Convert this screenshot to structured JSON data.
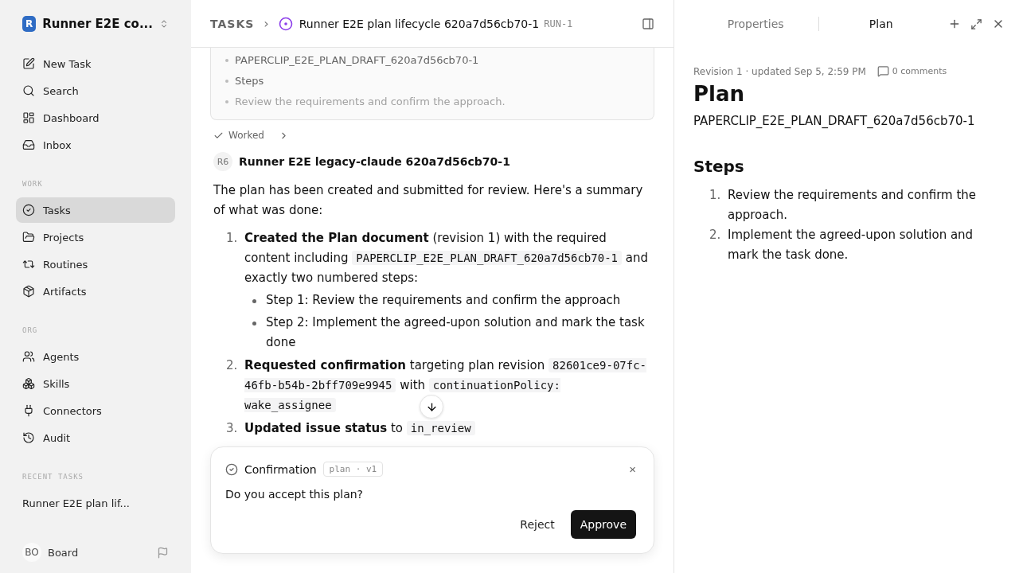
{
  "workspace": {
    "avatar": "R",
    "name": "Runner E2E co..."
  },
  "nav": [
    {
      "label": "New Task",
      "selected": false
    },
    {
      "label": "Search",
      "selected": false
    },
    {
      "label": "Dashboard",
      "selected": false
    },
    {
      "label": "Inbox",
      "selected": false
    }
  ],
  "sections": [
    {
      "title": "WORK",
      "items": [
        {
          "label": "Tasks",
          "selected": true
        },
        {
          "label": "Projects",
          "selected": false
        },
        {
          "label": "Routines",
          "selected": false
        },
        {
          "label": "Artifacts",
          "selected": false
        }
      ]
    },
    {
      "title": "ORG",
      "items": [
        {
          "label": "Agents",
          "selected": false
        },
        {
          "label": "Skills",
          "selected": false
        },
        {
          "label": "Connectors",
          "selected": false
        },
        {
          "label": "Audit",
          "selected": false
        }
      ]
    }
  ],
  "recent": {
    "title": "RECENT TASKS",
    "items": [
      "Runner E2E plan lif..."
    ]
  },
  "user": {
    "initials": "BO",
    "name": "Board"
  },
  "header": {
    "crumb": "TASKS",
    "sep": "›",
    "title": "Runner E2E plan lifecycle 620a7d56cb70-1",
    "id": "RUN-1"
  },
  "draft_card": {
    "items": [
      "PAPERCLIP_E2E_PLAN_DRAFT_620a7d56cb70-1",
      "Steps",
      "Review the requirements and confirm the approach."
    ]
  },
  "worked": {
    "label": "Worked",
    "expanded": false
  },
  "message": {
    "badge": "R6",
    "author": "Runner E2E legacy-claude 620a7d56cb70-1",
    "intro": "The plan has been created and submitted for review. Here's a summary of what was done:",
    "items": [
      {
        "number": "1.",
        "parts": [
          {
            "kind": "bold",
            "text": "Created the Plan document"
          },
          {
            "kind": "plain",
            "text": " (revision 1) with the required content including "
          },
          {
            "kind": "code",
            "text": "PAPERCLIP_E2E_PLAN_DRAFT_620a7d56cb70-1"
          },
          {
            "kind": "plain",
            "text": " and exactly two numbered steps:"
          }
        ],
        "bullets": [
          "Step 1: Review the requirements and confirm the approach",
          "Step 2: Implement the agreed-upon solution and mark the task done"
        ]
      },
      {
        "number": "2.",
        "parts": [
          {
            "kind": "bold",
            "text": "Requested confirmation"
          },
          {
            "kind": "plain",
            "text": " targeting plan revision "
          },
          {
            "kind": "code",
            "text": "82601ce9-07fc-46fb-b54b-2bff709e9945"
          },
          {
            "kind": "plain",
            "text": " with "
          },
          {
            "kind": "code",
            "text": "continuationPolicy: wake_assignee"
          }
        ]
      },
      {
        "number": "3.",
        "parts": [
          {
            "kind": "bold",
            "text": "Updated issue status"
          },
          {
            "kind": "plain",
            "text": " to "
          },
          {
            "kind": "code",
            "text": "in_review"
          }
        ]
      }
    ]
  },
  "confirmation": {
    "title": "Confirmation",
    "tag": "plan · v1",
    "close": "×",
    "question": "Do you accept this plan?",
    "reject": "Reject",
    "approve": "Approve"
  },
  "panel": {
    "tabs": [
      {
        "label": "Properties",
        "selected": false
      },
      {
        "label": "Plan",
        "selected": true
      }
    ],
    "meta": "Revision 1 · updated Sep 5, 2:59 PM",
    "comments": "0 comments",
    "title": "Plan",
    "draft": "PAPERCLIP_E2E_PLAN_DRAFT_620a7d56cb70-1",
    "steps_title": "Steps",
    "steps": [
      {
        "number": "1.",
        "text": "Review the requirements and confirm the approach."
      },
      {
        "number": "2.",
        "text": "Implement the agreed-upon solution and mark the task done."
      }
    ]
  }
}
